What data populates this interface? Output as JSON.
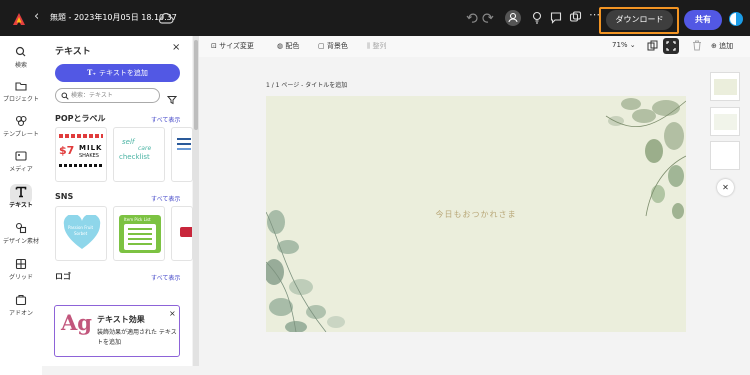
{
  "header": {
    "title": "無題 - 2023年10月05日 18.10.37",
    "download_label": "ダウンロード",
    "share_label": "共有",
    "back_glyph": "‹"
  },
  "rail": {
    "items": [
      {
        "label": "検索",
        "icon": "search-icon"
      },
      {
        "label": "プロジェクト",
        "icon": "folder-icon"
      },
      {
        "label": "テンプレート",
        "icon": "template-icon"
      },
      {
        "label": "メディア",
        "icon": "media-icon"
      },
      {
        "label": "テキスト",
        "icon": "text-icon"
      },
      {
        "label": "デザイン素材",
        "icon": "shapes-icon"
      },
      {
        "label": "グリッド",
        "icon": "grid-icon"
      },
      {
        "label": "アドオン",
        "icon": "addon-icon"
      }
    ],
    "selected": "テキスト"
  },
  "panel": {
    "title": "テキスト",
    "close_glyph": "×",
    "add_text_label": "テキストを追加",
    "search_placeholder": "検索：テキスト",
    "sections": [
      {
        "label": "POPとラベル",
        "see_all": "すべて表示"
      },
      {
        "label": "SNS",
        "see_all": "すべて表示"
      },
      {
        "label": "ロゴ",
        "see_all": "すべて表示"
      }
    ],
    "pop_thumbs": [
      {
        "lines": [
          "$7",
          "MILK",
          "SHAKES"
        ]
      },
      {
        "lines": [
          "self",
          "care",
          "checklist"
        ]
      }
    ],
    "sns_thumbs": [
      {
        "lines": [
          "Passion Fruit",
          "Sorbet"
        ]
      },
      {
        "lines": [
          "Item Pick List"
        ]
      }
    ],
    "effect_card": {
      "glyph": "Ag",
      "title": "テキスト効果",
      "description": "装飾効果が適用された テキストを追加",
      "close_glyph": "×"
    }
  },
  "toolbar": {
    "resize": "サイズ変更",
    "color": "配色",
    "background": "背景色",
    "arrange": "整列",
    "zoom": "71%",
    "add": "追加"
  },
  "canvas": {
    "page_label": "1 / 1 ページ - タイトルを追加",
    "main_text": "今日もおつかれさま",
    "background_color": "#ebeedc",
    "text_color": "#b9a879"
  },
  "colors": {
    "accent": "#5258e4",
    "download_highlight": "#f29423",
    "topbar": "#1b1b1b"
  }
}
